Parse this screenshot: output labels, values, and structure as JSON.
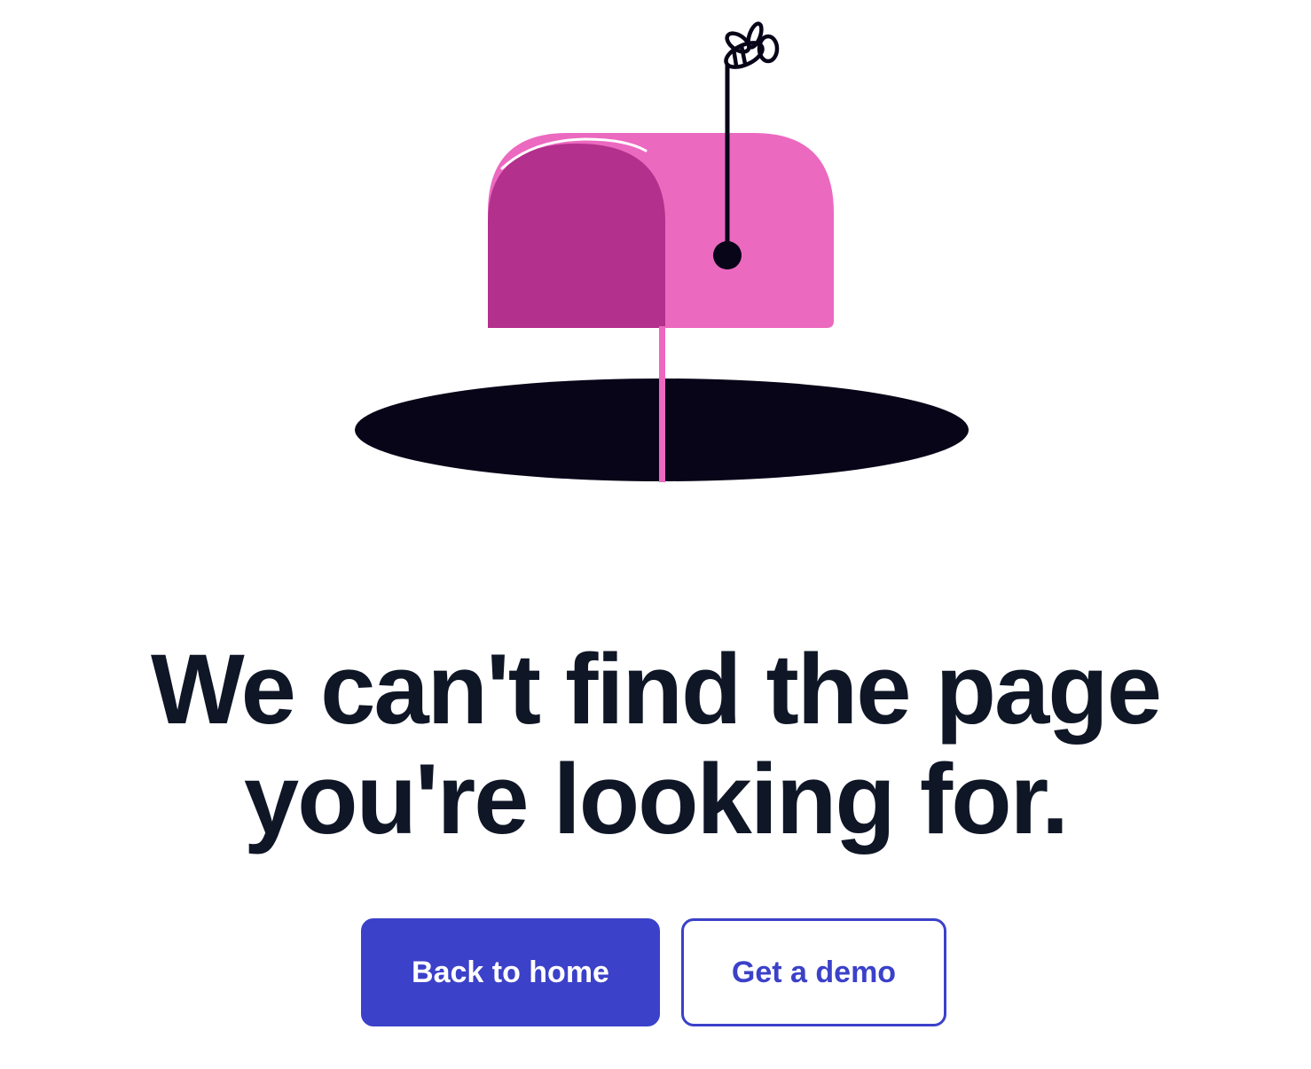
{
  "illustration": {
    "name": "mailbox-illustration",
    "colors": {
      "mailbox_body": "#ec69c0",
      "mailbox_door": "#b3308c",
      "mailbox_highlight": "#ffffff",
      "hole": "#080518",
      "post": "#ec69c0",
      "flag_pole": "#080518"
    }
  },
  "headline": {
    "line1": "We can't find the page",
    "line2": "you're looking for."
  },
  "buttons": {
    "primary_label": "Back to home",
    "secondary_label": "Get a demo"
  },
  "colors": {
    "text": "#0f1626",
    "accent": "#3b41c9",
    "background": "#ffffff"
  }
}
